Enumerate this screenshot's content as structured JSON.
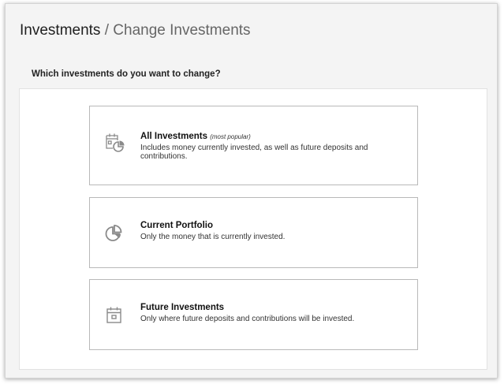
{
  "header": {
    "root": "Investments",
    "separator": "/",
    "current": "Change Investments"
  },
  "question": "Which investments do you want to change?",
  "options": [
    {
      "title": "All Investments",
      "note": "(most popular)",
      "description": "Includes money currently invested, as well as future deposits and contributions.",
      "icon": "calendar-pie-chart-icon"
    },
    {
      "title": "Current Portfolio",
      "note": "",
      "description": "Only the money that is currently invested.",
      "icon": "pie-chart-icon"
    },
    {
      "title": "Future Investments",
      "note": "",
      "description": "Only where future deposits and contributions will be invested.",
      "icon": "calendar-icon"
    }
  ],
  "colors": {
    "icon": "#8a8a8a",
    "border": "#b9b9b9",
    "background": "#f4f4f4"
  }
}
